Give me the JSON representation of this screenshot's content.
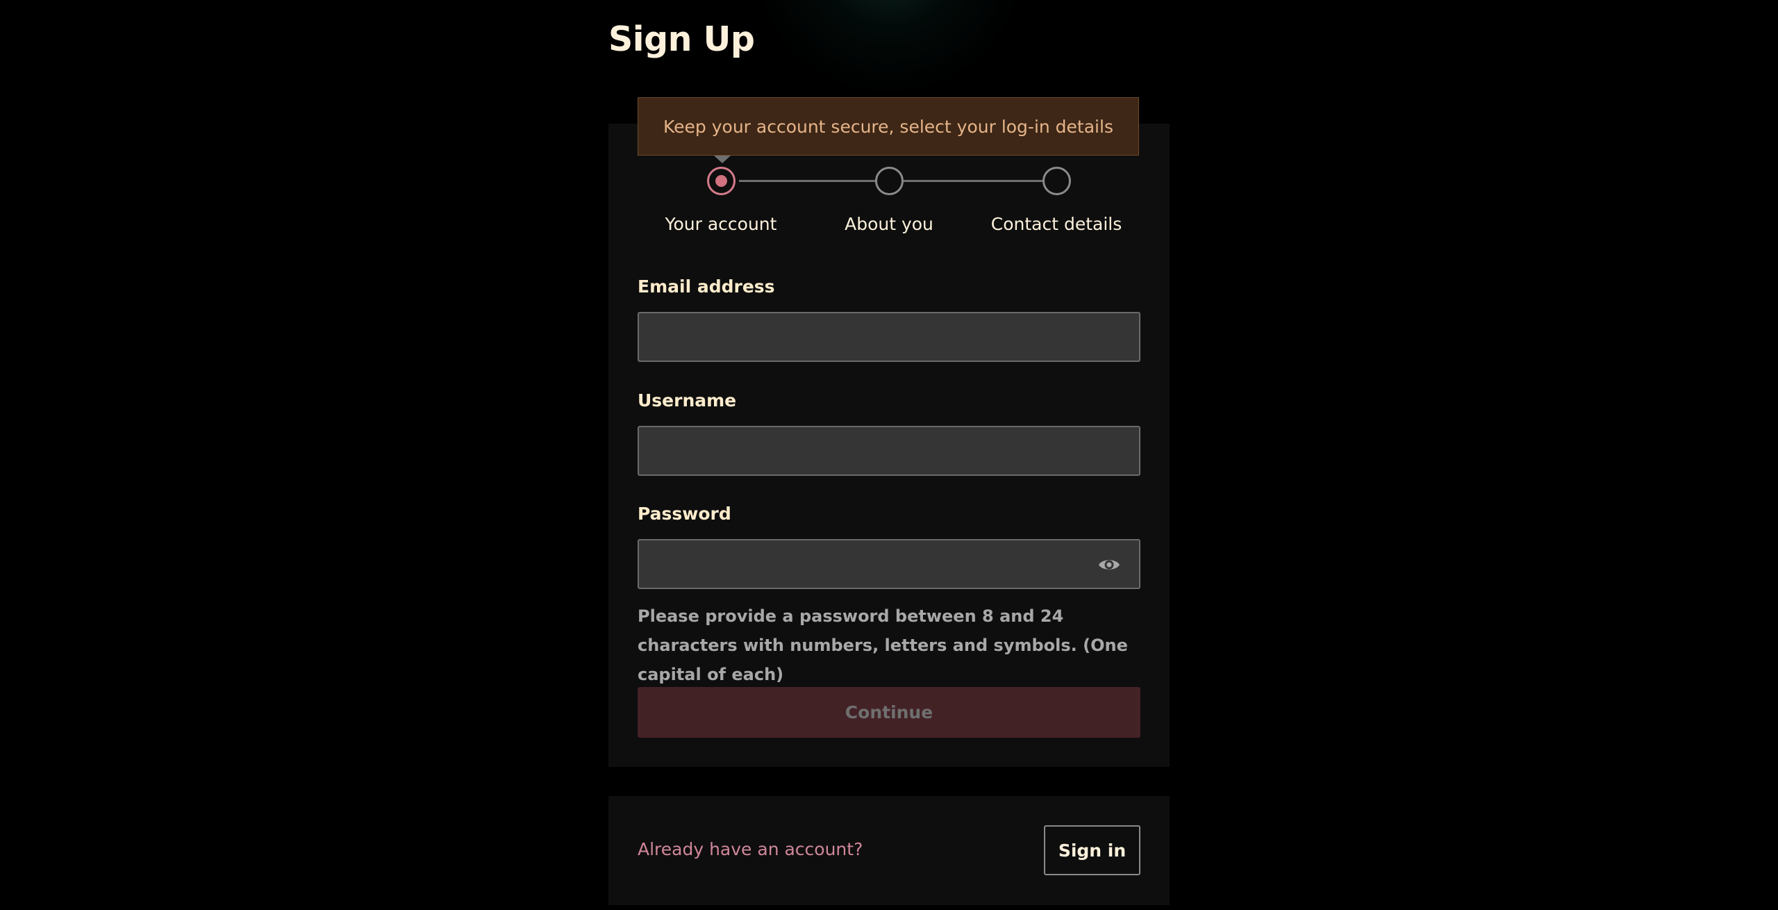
{
  "page": {
    "title": "Sign Up"
  },
  "tooltip": {
    "text": "Keep your account secure, select your log-in details"
  },
  "steps": [
    {
      "label": "Your account",
      "active": true
    },
    {
      "label": "About you",
      "active": false
    },
    {
      "label": "Contact details",
      "active": false
    }
  ],
  "form": {
    "email": {
      "label": "Email address",
      "value": "",
      "placeholder": ""
    },
    "username": {
      "label": "Username",
      "value": "",
      "placeholder": ""
    },
    "password": {
      "label": "Password",
      "value": "",
      "placeholder": ""
    },
    "password_hint": "Please provide a password between 8 and 24 characters with numbers, letters and symbols. (One capital of each)",
    "continue_label": "Continue"
  },
  "signin": {
    "prompt": "Already have an account?",
    "button_label": "Sign in"
  },
  "icons": {
    "password_toggle": "eye-icon"
  },
  "colors": {
    "background": "#000000",
    "card": "#0e0e0e",
    "accent": "#d0727f",
    "tooltip_bg": "#3e2716",
    "tooltip_text": "#e6b48a",
    "continue_disabled_bg": "#432226",
    "label_text": "#fdeccc"
  }
}
